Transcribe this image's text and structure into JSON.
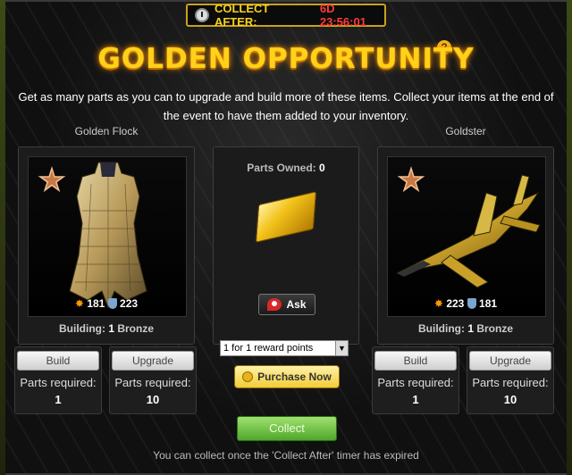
{
  "timer": {
    "label": "COLLECT AFTER:",
    "value": "6D 23:56:01"
  },
  "help": {
    "glyph": "?"
  },
  "title": "GOLDEN OPPORTUNITY",
  "description": "Get as many parts as you can to upgrade and build more of these items. Collect your items at the end of the event to have them added to your inventory.",
  "items": [
    {
      "name": "Golden Flock",
      "attack": "181",
      "defense": "223",
      "building_label": "Building:",
      "building_level": "1",
      "building_tier": "Bronze",
      "build": {
        "label": "Build",
        "parts_label": "Parts required:",
        "parts": "1"
      },
      "upgrade": {
        "label": "Upgrade",
        "parts_label": "Parts required:",
        "parts": "10"
      }
    },
    {
      "name": "Goldster",
      "attack": "223",
      "defense": "181",
      "building_label": "Building:",
      "building_level": "1",
      "building_tier": "Bronze",
      "build": {
        "label": "Build",
        "parts_label": "Parts required:",
        "parts": "1"
      },
      "upgrade": {
        "label": "Upgrade",
        "parts_label": "Parts required:",
        "parts": "10"
      }
    }
  ],
  "middle": {
    "parts_owned_label": "Parts Owned:",
    "parts_owned": "0",
    "ask_label": "Ask",
    "reward_option": "1 for 1 reward points",
    "purchase_label": "Purchase Now"
  },
  "collect": {
    "label": "Collect",
    "note": "You can collect once the 'Collect After' timer has expired"
  },
  "colors": {
    "accent_gold": "#ffd21a",
    "timer_red": "#ff3a3a",
    "collect_green": "#4fa72a"
  }
}
